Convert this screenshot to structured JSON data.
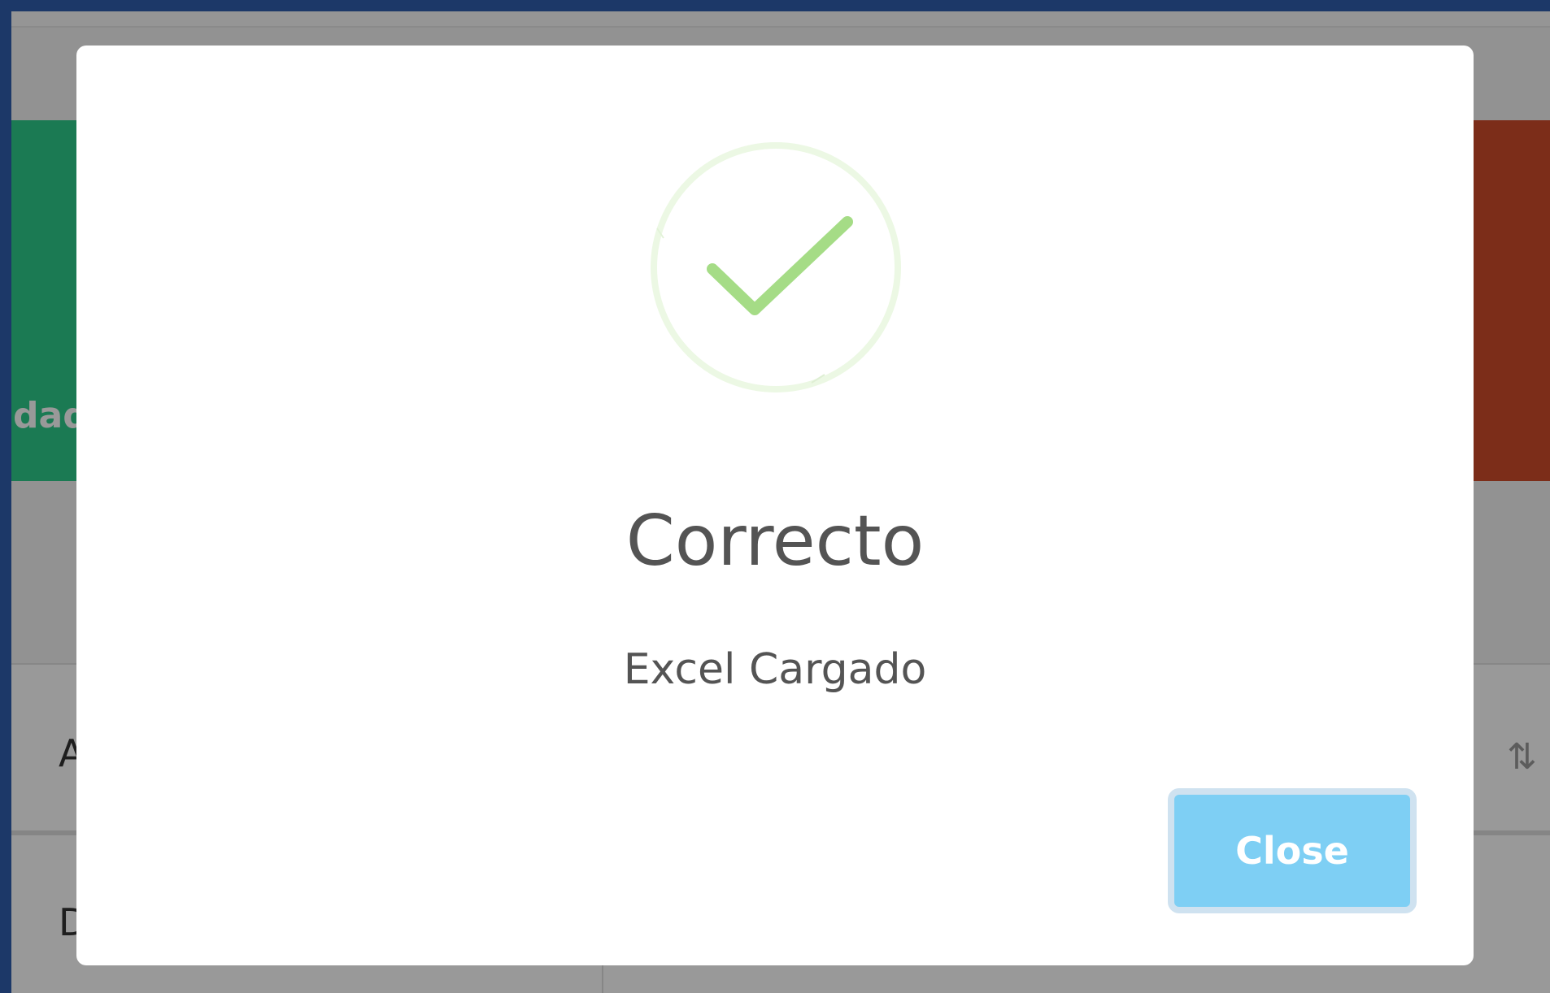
{
  "background": {
    "green_card_label": "dad",
    "table_header_first": "A",
    "table_sort_icon": "sort-arrows-icon",
    "table_row_first": "D",
    "colors": {
      "frame": "#1c3868",
      "green_card": "#2ecc8a",
      "red_card": "#cf4b2a"
    }
  },
  "modal": {
    "icon": "success-check-icon",
    "title": "Correcto",
    "text": "Excel Cargado",
    "close_label": "Close",
    "colors": {
      "check": "#a5dc86",
      "ring": "#ecf8e4",
      "button": "#7ecff4",
      "button_focus_ring": "#cfe2f0",
      "text": "#545454"
    }
  }
}
